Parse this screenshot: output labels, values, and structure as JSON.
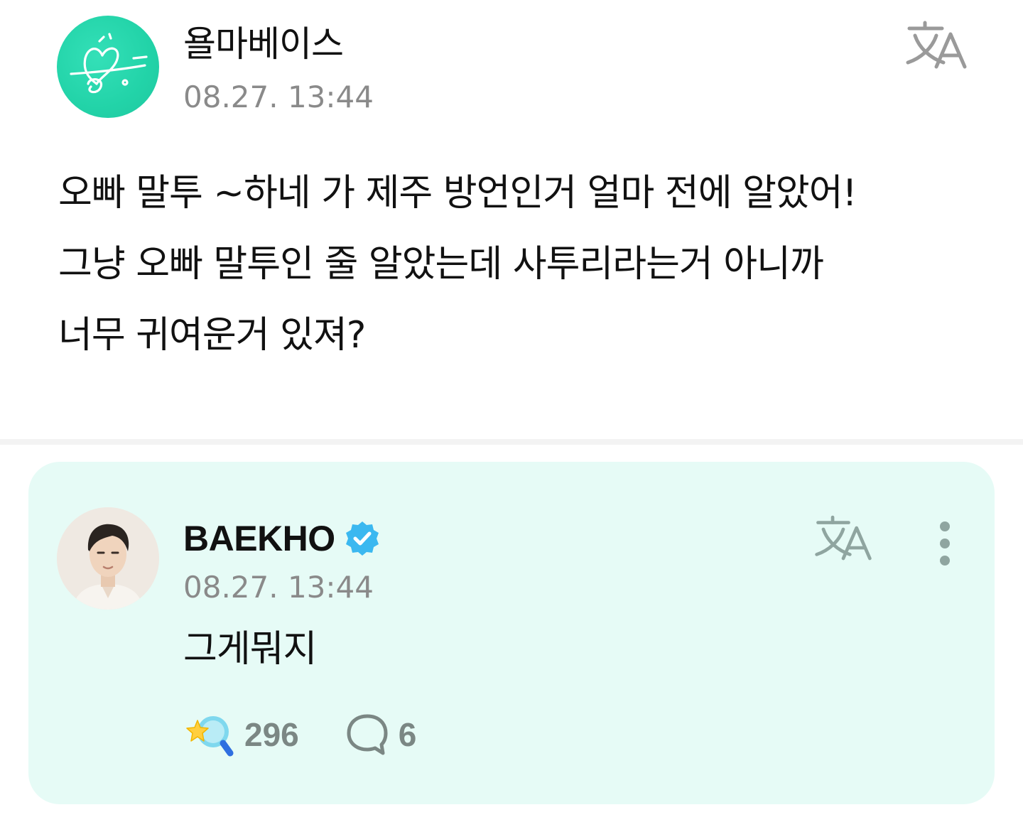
{
  "post": {
    "author": "욜마베이스",
    "timestamp": "08.27. 13:44",
    "translate_icon": "translate-icon",
    "body_lines": [
      "오빠 말투 ~하네 가 제주 방언인거 얼마 전에 알았어!",
      "그냥 오빠 말투인 줄 알았는데 사투리라는거 아니까",
      "너무 귀여운거 있져?"
    ]
  },
  "reply": {
    "author": "BAEKHO",
    "verified_icon": "verified-badge-icon",
    "timestamp": "08.27. 13:44",
    "text": "그게뭐지",
    "translate_icon": "translate-icon",
    "more_icon": "more-vertical-icon",
    "like_count": "296",
    "like_icon": "star-search-like-icon",
    "comment_count": "6",
    "comment_icon": "comment-bubble-icon"
  },
  "colors": {
    "card_background": "#e6fbf6",
    "accent_teal": "#22d3a8",
    "verified_blue": "#3bb8f0",
    "muted_text": "#8a8a8a",
    "icon_gray": "#8fa5a0"
  }
}
